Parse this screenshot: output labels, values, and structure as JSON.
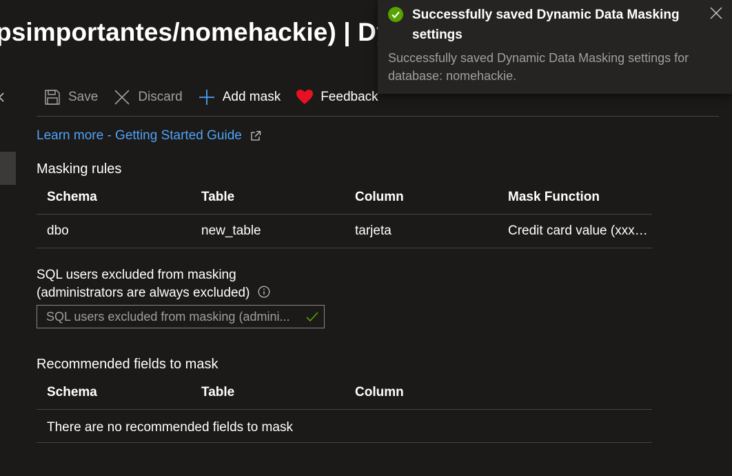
{
  "page": {
    "title": "psimportantes/nomehackie) | Dyna"
  },
  "toolbar": {
    "save_label": "Save",
    "discard_label": "Discard",
    "add_mask_label": "Add mask",
    "feedback_label": "Feedback"
  },
  "learn_more": {
    "label": "Learn more - Getting Started Guide"
  },
  "masking_rules": {
    "title": "Masking rules",
    "columns": [
      "Schema",
      "Table",
      "Column",
      "Mask Function"
    ],
    "rows": [
      [
        "dbo",
        "new_table",
        "tarjeta",
        "Credit card value (xxxx..."
      ]
    ]
  },
  "excluded_users": {
    "label_line1": "SQL users excluded from masking",
    "label_line2": "(administrators are always excluded)",
    "placeholder": "SQL users excluded from masking (admini..."
  },
  "recommended": {
    "title": "Recommended fields to mask",
    "columns": [
      "Schema",
      "Table",
      "Column"
    ],
    "empty_message": "There are no recommended fields to mask"
  },
  "toast": {
    "title": "Successfully saved Dynamic Data Masking settings",
    "body": "Successfully saved Dynamic Data Masking settings for database: nomehackie."
  },
  "colors": {
    "background": "#1b1a19",
    "link": "#4fa3f7",
    "success": "#57a300",
    "feedback_heart": "#e81123",
    "add_icon": "#4fa3f7",
    "disabled_text": "#a19f9d"
  },
  "icons": {
    "save": "save-icon",
    "discard": "discard-icon",
    "add": "add-icon",
    "feedback": "heart-icon",
    "external": "external-link-icon",
    "info": "info-icon",
    "valid": "checkmark-icon",
    "toast_status": "success-check-icon",
    "close": "close-icon"
  }
}
